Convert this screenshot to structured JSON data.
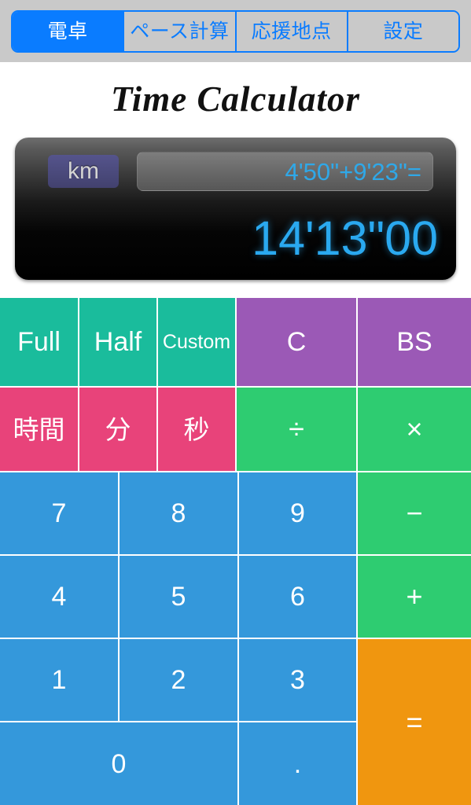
{
  "tabs": [
    {
      "label": "電卓",
      "active": true
    },
    {
      "label": "ペース計算",
      "active": false
    },
    {
      "label": "応援地点",
      "active": false
    },
    {
      "label": "設定",
      "active": false
    }
  ],
  "header": {
    "title": "Time Calculator"
  },
  "display": {
    "unit": "km",
    "formula": "4'50\"+9'23\"=",
    "result": "14'13\"00"
  },
  "keys": {
    "full": "Full",
    "half": "Half",
    "custom": "Custom",
    "clear": "C",
    "backspace": "BS",
    "hour": "時間",
    "minute": "分",
    "second": "秒",
    "divide": "÷",
    "multiply": "×",
    "seven": "7",
    "eight": "8",
    "nine": "9",
    "minus": "−",
    "four": "4",
    "five": "5",
    "six": "6",
    "plus": "+",
    "one": "1",
    "two": "2",
    "three": "3",
    "equals": "=",
    "zero": "0",
    "dot": "."
  },
  "colors": {
    "accent_blue": "#0a7cff",
    "tabbar_bg": "#c9c9c9",
    "teal": "#1abc9c",
    "purple": "#9b59b6",
    "pink": "#e8437a",
    "green": "#2ecc71",
    "blue": "#3498db",
    "orange": "#f0960f",
    "display_text": "#2aa9f0",
    "unit_badge": "#4a4980"
  }
}
